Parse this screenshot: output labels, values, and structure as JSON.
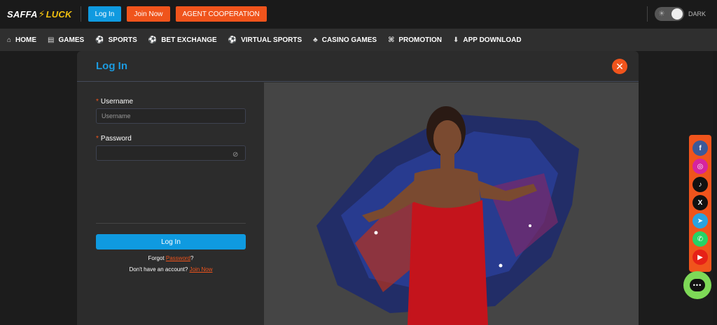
{
  "brand": {
    "part1": "SAFFA",
    "part2": "LUCK"
  },
  "top": {
    "login_label": "Log In",
    "join_label": "Join Now",
    "agent_label": "AGENT COOPERATION",
    "theme_label": "DARK"
  },
  "nav": {
    "items": [
      {
        "label": "HOME",
        "icon": "home-icon"
      },
      {
        "label": "GAMES",
        "icon": "games-icon"
      },
      {
        "label": "SPORTS",
        "icon": "soccer-ball-icon"
      },
      {
        "label": "BET EXCHANGE",
        "icon": "soccer-ball-icon"
      },
      {
        "label": "VIRTUAL SPORTS",
        "icon": "soccer-ball-icon"
      },
      {
        "label": "CASINO GAMES",
        "icon": "cards-icon"
      },
      {
        "label": "PROMOTION",
        "icon": "gift-icon"
      },
      {
        "label": "APP DOWNLOAD",
        "icon": "download-icon"
      }
    ]
  },
  "modal": {
    "title": "Log In",
    "username_label": "Username",
    "username_placeholder": "Username",
    "password_label": "Password",
    "password_placeholder": "",
    "submit_label": "Log In",
    "forgot_prefix": "Forgot ",
    "forgot_link": "Password",
    "forgot_suffix": "?",
    "signup_prefix": "Don't have an account? ",
    "signup_link": "Join Now"
  },
  "social": [
    {
      "name": "facebook-icon",
      "glyph": "f",
      "color": "#3b5998"
    },
    {
      "name": "instagram-icon",
      "glyph": "◎",
      "color": "#d6249f"
    },
    {
      "name": "tiktok-icon",
      "glyph": "♪",
      "color": "#111111"
    },
    {
      "name": "x-icon",
      "glyph": "X",
      "color": "#111111"
    },
    {
      "name": "telegram-icon",
      "glyph": "➤",
      "color": "#2aa3e0"
    },
    {
      "name": "whatsapp-icon",
      "glyph": "✆",
      "color": "#25d366"
    },
    {
      "name": "youtube-icon",
      "glyph": "▶",
      "color": "#e62117"
    }
  ],
  "colors": {
    "accent_blue": "#0f9ae0",
    "accent_orange": "#f0541c",
    "brand_yellow": "#f2c10f",
    "chat_green": "#7ed957"
  }
}
